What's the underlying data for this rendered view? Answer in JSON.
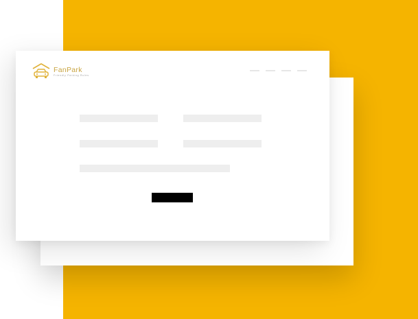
{
  "app": {
    "name": "FanPark",
    "tagline": "Friendly Parking Rules",
    "accent_color": "#F5B400",
    "logo_color": "#C9A441"
  },
  "nav": {
    "items": [
      "",
      "",
      "",
      ""
    ]
  },
  "form": {
    "fields": [
      {
        "id": "field-1",
        "value": ""
      },
      {
        "id": "field-2",
        "value": ""
      },
      {
        "id": "field-3",
        "value": ""
      },
      {
        "id": "field-4",
        "value": ""
      },
      {
        "id": "field-5",
        "value": ""
      }
    ],
    "submit_label": ""
  },
  "icons": {
    "logo": "car-garage-icon"
  }
}
